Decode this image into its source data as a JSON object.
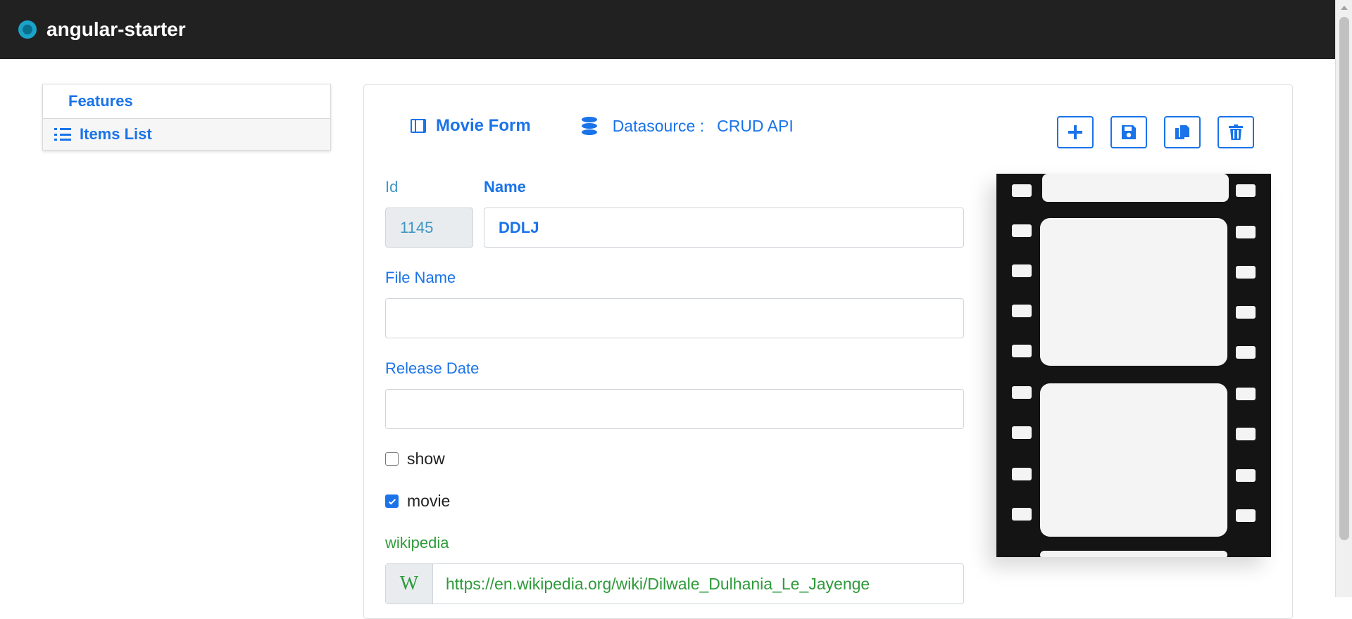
{
  "navbar": {
    "title": "angular-starter"
  },
  "sidebar": {
    "header": "Features",
    "items": [
      {
        "label": "Items List",
        "icon": "list-icon"
      }
    ]
  },
  "card": {
    "title": "Movie Form",
    "datasource_label": "Datasource :",
    "datasource_value": "CRUD API",
    "toolbar": [
      "plus-icon",
      "save-icon",
      "copy-icon",
      "trash-icon"
    ]
  },
  "form": {
    "id_label": "Id",
    "id_value": "1145",
    "name_label": "Name",
    "name_value": "DDLJ",
    "filename_label": "File Name",
    "filename_value": "",
    "release_label": "Release Date",
    "release_value": "",
    "show_label": "show",
    "show_checked": false,
    "movie_label": "movie",
    "movie_checked": true,
    "wiki_label": "wikipedia",
    "wiki_addon": "W",
    "wiki_url": "https://en.wikipedia.org/wiki/Dilwale_Dulhania_Le_Jayenge"
  },
  "colors": {
    "primary": "#1a73e8",
    "navbar": "#212121",
    "wiki": "#2e9a3a"
  }
}
